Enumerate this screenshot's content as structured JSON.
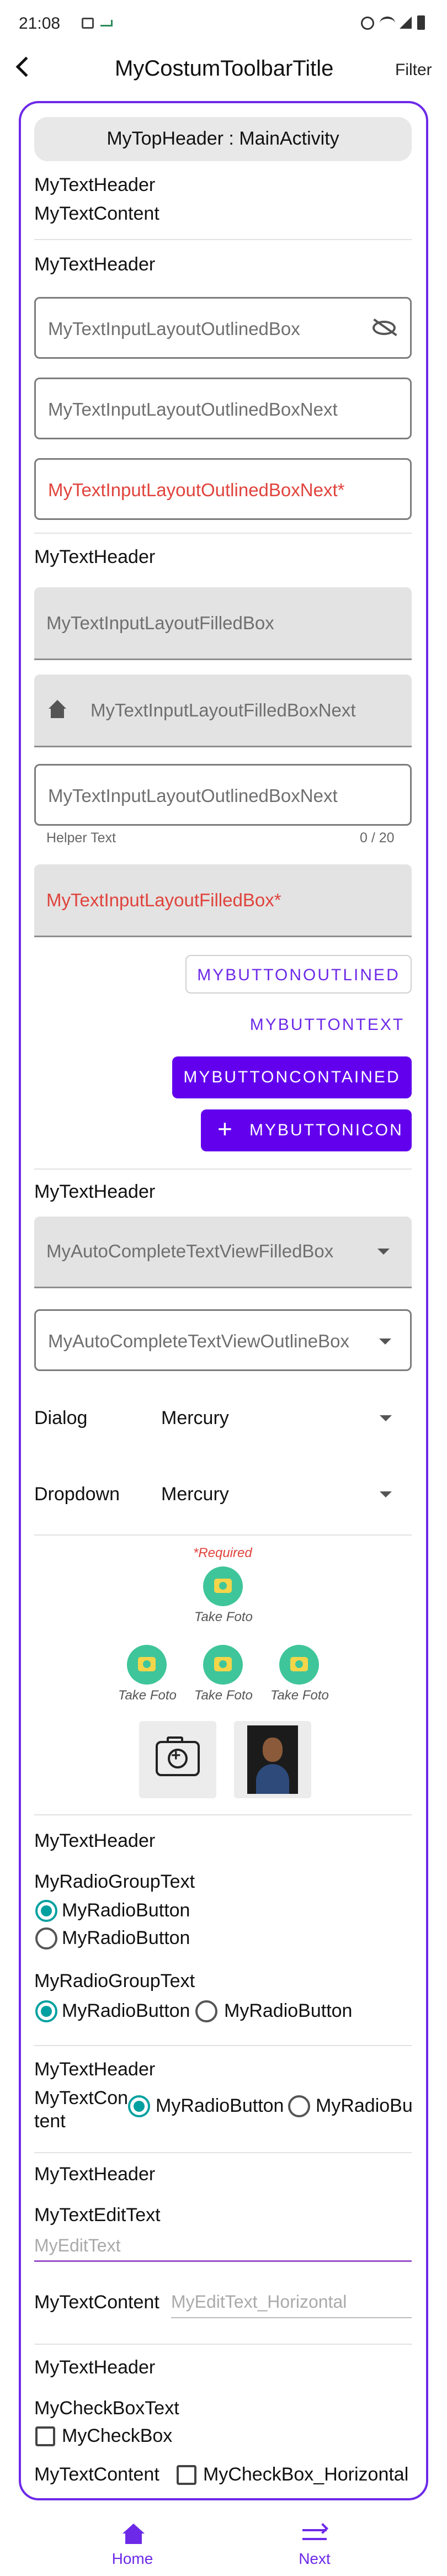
{
  "status_bar": {
    "time": "21:08"
  },
  "toolbar": {
    "title": "MyCostumToolbarTitle",
    "filter": "Filter"
  },
  "top_header": "MyTopHeader : MainActivity",
  "section1": {
    "header": "MyTextHeader",
    "content": "MyTextContent"
  },
  "section2": {
    "header": "MyTextHeader",
    "field1": "MyTextInputLayoutOutlinedBox",
    "field2": "MyTextInputLayoutOutlinedBoxNext",
    "field3": "MyTextInputLayoutOutlinedBoxNext*"
  },
  "section3": {
    "header": "MyTextHeader",
    "field1": "MyTextInputLayoutFilledBox",
    "field2": "MyTextInputLayoutFilledBoxNext",
    "field3": "MyTextInputLayoutOutlinedBoxNext",
    "helper": "Helper Text",
    "counter": "0 / 20",
    "field4": "MyTextInputLayoutFilledBox*"
  },
  "buttons": {
    "outlined": "MYBUTTONOUTLINED",
    "text": "MYBUTTONTEXT",
    "contained": "MYBUTTONCONTAINED",
    "icon": "MYBUTTONICON"
  },
  "section4": {
    "header": "MyTextHeader",
    "auto1": "MyAutoCompleteTextViewFilledBox",
    "auto2": "MyAutoCompleteTextViewOutlineBox",
    "dialog_label": "Dialog",
    "dialog_value": "Mercury",
    "dropdown_label": "Dropdown",
    "dropdown_value": "Mercury"
  },
  "photos": {
    "required": "*Required",
    "take1": "Take Foto",
    "take2": "Take Foto",
    "take3": "Take Foto",
    "take4": "Take Foto"
  },
  "radio1": {
    "header": "MyTextHeader",
    "group1": "MyRadioGroupText",
    "r1": "MyRadioButton",
    "r2": "MyRadioButton",
    "group2": "MyRadioGroupText",
    "r3": "MyRadioButton",
    "r4": "MyRadioButton"
  },
  "radio2": {
    "header": "MyTextHeader",
    "label": "MyTextCon tent",
    "r1": "MyRadioButton",
    "r2": "MyRadioBu"
  },
  "edit": {
    "header": "MyTextHeader",
    "label": "MyTextEditText",
    "placeholder": "MyEditText",
    "content": "MyTextContent",
    "placeholder_h": "MyEditText_Horizontal"
  },
  "check": {
    "header": "MyTextHeader",
    "label": "MyCheckBoxText",
    "cb1": "MyCheckBox",
    "content": "MyTextContent",
    "cb2": "MyCheckBox_Horizontal"
  },
  "bottom_nav": {
    "home": "Home",
    "next": "Next"
  },
  "colors": {
    "accent": "#6d29e8",
    "teal": "#00a0a0",
    "error": "#e0433c"
  }
}
